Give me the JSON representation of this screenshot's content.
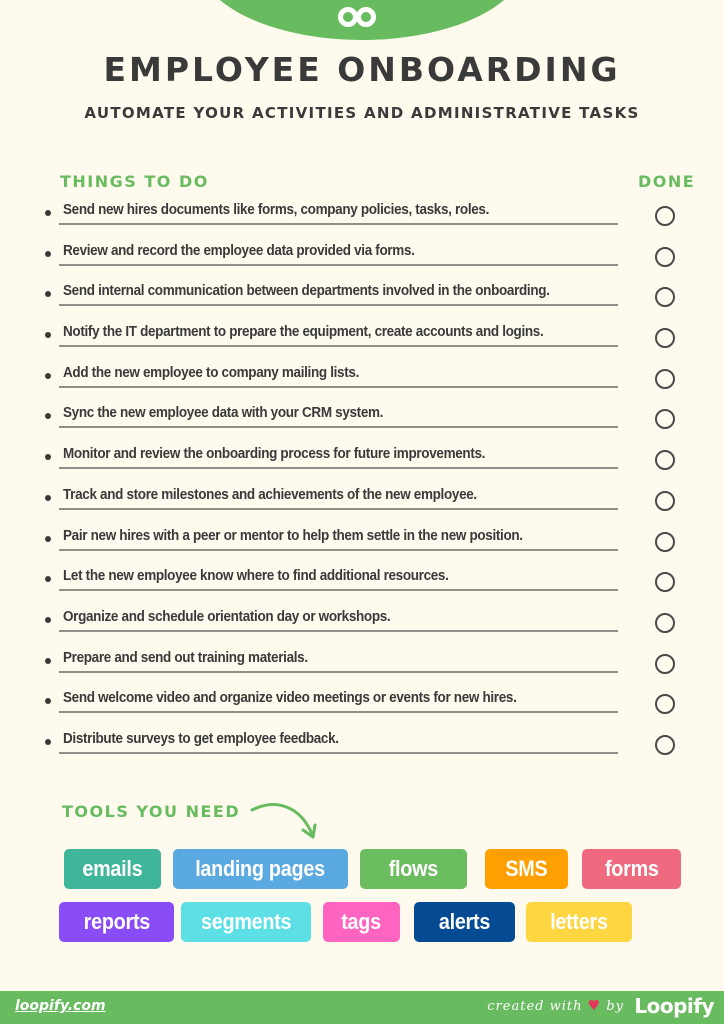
{
  "header": {
    "logo_icon": "infinity-loop-icon",
    "title": "EMPLOYEE ONBOARDING",
    "subtitle": "AUTOMATE YOUR ACTIVITIES AND ADMINISTRATIVE TASKS"
  },
  "checklist": {
    "things_heading": "THINGS TO DO",
    "done_heading": "DONE",
    "tasks": [
      {
        "text": "Send new hires documents like forms, company policies, tasks, roles.",
        "done": false
      },
      {
        "text": "Review and record the employee data provided via forms.",
        "done": false
      },
      {
        "text": "Send internal communication between departments involved in the onboarding.",
        "done": false
      },
      {
        "text": "Notify the IT department to prepare the equipment, create accounts and logins.",
        "done": false
      },
      {
        "text": "Add the new employee to company mailing lists.",
        "done": false
      },
      {
        "text": "Sync the new employee data with your CRM system.",
        "done": false
      },
      {
        "text": "Monitor and review the onboarding process for future improvements.",
        "done": false
      },
      {
        "text": "Track and store milestones and achievements of the new employee.",
        "done": false
      },
      {
        "text": "Pair new hires with a peer or mentor to help them settle in the new position.",
        "done": false
      },
      {
        "text": "Let the new employee know where to find additional resources.",
        "done": false
      },
      {
        "text": "Organize and schedule orientation day or workshops.",
        "done": false
      },
      {
        "text": "Prepare and send out training materials.",
        "done": false
      },
      {
        "text": "Send welcome video and organize video meetings or events for new hires.",
        "done": false
      },
      {
        "text": "Distribute surveys to get employee feedback.",
        "done": false
      }
    ]
  },
  "tools": {
    "heading": "TOOLS YOU NEED",
    "items": [
      {
        "label": "emails",
        "color": "#3fb599"
      },
      {
        "label": "landing pages",
        "color": "#5aa9e0"
      },
      {
        "label": "flows",
        "color": "#6cbd5f"
      },
      {
        "label": "SMS",
        "color": "#ffa000"
      },
      {
        "label": "forms",
        "color": "#ef6a7e"
      },
      {
        "label": "reports",
        "color": "#8a4cf7"
      },
      {
        "label": "segments",
        "color": "#5ce0e6"
      },
      {
        "label": "tags",
        "color": "#ff64c0"
      },
      {
        "label": "alerts",
        "color": "#044b94"
      },
      {
        "label": "letters",
        "color": "#fed641"
      }
    ]
  },
  "footer": {
    "link": "loopify.com",
    "created_with": "created with",
    "by": "by",
    "brand": "Loopify"
  },
  "colors": {
    "accent_green": "#68bb5f",
    "background": "#fefaee",
    "text": "#3a3a3a",
    "heart": "#e8355c"
  }
}
